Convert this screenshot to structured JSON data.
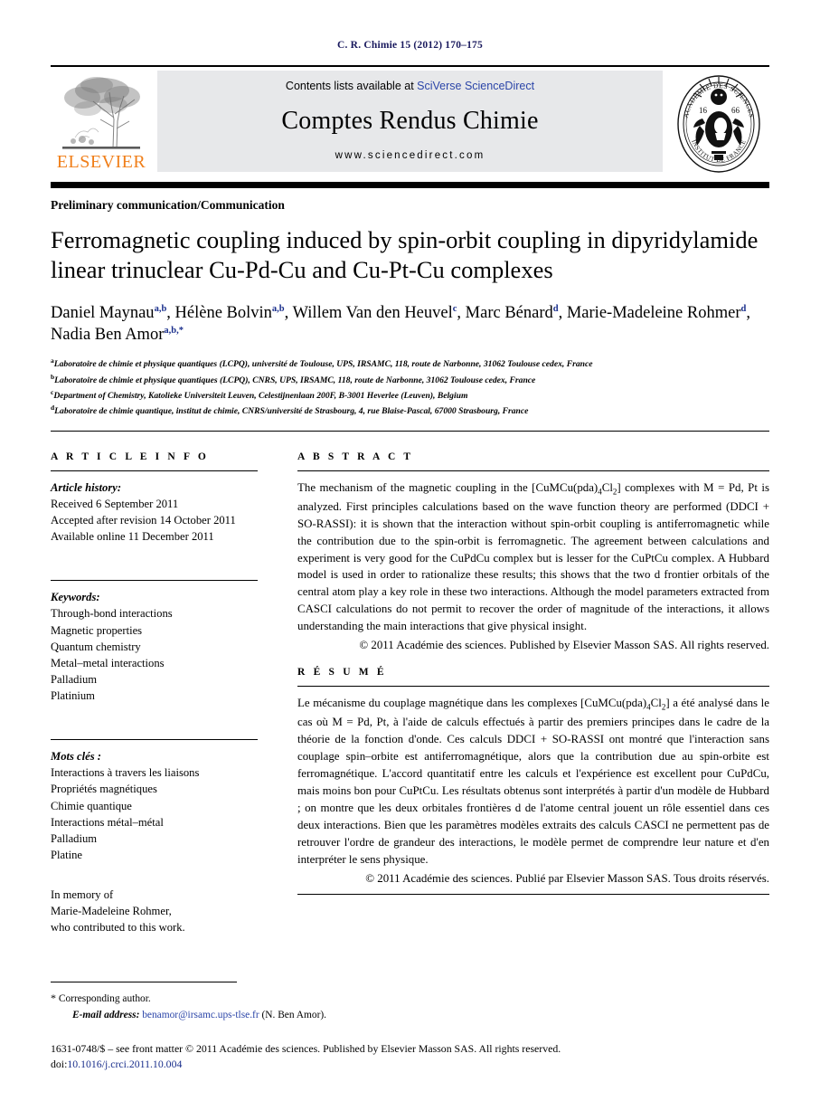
{
  "running_head": "C. R. Chimie 15 (2012) 170–175",
  "masthead": {
    "publisher_name": "ELSEVIER",
    "contents_prefix": "Contents lists available at ",
    "contents_link": "SciVerse ScienceDirect",
    "journal_title": "Comptes Rendus Chimie",
    "journal_url": "www.sciencedirect.com",
    "seal_outer_top": "ACADÉMIE DES",
    "seal_outer_bottom": "INSTITUT DE FRANCE",
    "seal_year_left": "16",
    "seal_year_right": "66"
  },
  "article": {
    "section_label": "Preliminary communication/Communication",
    "title_line1": "Ferromagnetic coupling induced by spin-orbit coupling in dipyridylamide",
    "title_line2": "linear trinuclear Cu-Pd-Cu and Cu-Pt-Cu complexes",
    "authors": [
      {
        "name": "Daniel Maynau",
        "marks": "a,b",
        "sep": ", "
      },
      {
        "name": "Hélène Bolvin",
        "marks": "a,b",
        "sep": ", "
      },
      {
        "name": "Willem Van den Heuvel",
        "marks": "c",
        "sep": ", "
      },
      {
        "name": "Marc Bénard",
        "marks": "d",
        "sep": ", "
      },
      {
        "name": "Marie-Madeleine Rohmer",
        "marks": "d",
        "sep": ", "
      },
      {
        "name": "Nadia Ben Amor",
        "marks": "a,b,*",
        "sep": ""
      }
    ],
    "affiliations": [
      {
        "mark": "a",
        "text": "Laboratoire de chimie et physique quantiques (LCPQ), université de Toulouse, UPS, IRSAMC, 118, route de Narbonne, 31062 Toulouse cedex, France"
      },
      {
        "mark": "b",
        "text": "Laboratoire de chimie et physique quantiques (LCPQ), CNRS, UPS, IRSAMC, 118, route de Narbonne, 31062 Toulouse cedex, France"
      },
      {
        "mark": "c",
        "text": "Department of Chemistry, Katolieke Universiteit Leuven, Celestijnenlaan 200F, B-3001 Heverlee (Leuven), Belgium"
      },
      {
        "mark": "d",
        "text": "Laboratoire de chimie quantique, institut de chimie, CNRS/université de Strasbourg, 4, rue Blaise-Pascal, 67000 Strasbourg, France"
      }
    ]
  },
  "info": {
    "heading": "A R T I C L E   I N F O",
    "history_label": "Article history:",
    "history": [
      "Received 6 September 2011",
      "Accepted after revision 14 October 2011",
      "Available online 11 December 2011"
    ],
    "keywords_label": "Keywords:",
    "keywords": [
      "Through-bond interactions",
      "Magnetic properties",
      "Quantum chemistry",
      "Metal–metal interactions",
      "Palladium",
      "Platinium"
    ],
    "motscles_label": "Mots clés :",
    "motscles": [
      "Interactions à travers les liaisons",
      "Propriétés magnétiques",
      "Chimie quantique",
      "Interactions métal–métal",
      "Palladium",
      "Platine"
    ],
    "memoriam": [
      "In memory of",
      "Marie-Madeleine Rohmer,",
      "who contributed to this work."
    ]
  },
  "abstract": {
    "heading": "A B S T R A C T",
    "body_part1": "The mechanism of the magnetic coupling in the [CuMCu(pda)",
    "body_sub1": "4",
    "body_part2": "Cl",
    "body_sub2": "2",
    "body_part3": "] complexes with M = Pd, Pt is analyzed. First principles calculations based on the wave function theory are performed (DDCI + SO-RASSI): it is shown that the interaction without spin-orbit coupling is antiferromagnetic while the contribution due to the spin-orbit is ferromagnetic. The agreement between calculations and experiment is very good for the CuPdCu complex but is lesser for the CuPtCu complex. A Hubbard model is used in order to rationalize these results; this shows that the two d frontier orbitals of the central atom play a key role in these two interactions. Although the model parameters extracted from CASCI calculations do not permit to recover the order of magnitude of the interactions, it allows understanding the main interactions that give physical insight.",
    "copyright": "© 2011 Académie des sciences. Published by Elsevier Masson SAS. All rights reserved."
  },
  "resume": {
    "heading": "R É S U M É",
    "body_part1": "Le mécanisme du couplage magnétique dans les complexes [CuMCu(pda)",
    "body_sub1": "4",
    "body_part2": "Cl",
    "body_sub2": "2",
    "body_part3": "] a été analysé dans le cas où M = Pd, Pt, à l'aide de calculs effectués à partir des premiers principes dans le cadre de la théorie de la fonction d'onde. Ces calculs DDCI + SO-RASSI ont montré que l'interaction sans couplage spin–orbite est antiferromagnétique, alors que la contribution due au spin-orbite est ferromagnétique. L'accord quantitatif entre les calculs et l'expérience est excellent pour CuPdCu, mais moins bon pour CuPtCu. Les résultats obtenus sont interprétés à partir d'un modèle de Hubbard ; on montre que les deux orbitales frontières d de l'atome central jouent un rôle essentiel dans ces deux interactions. Bien que les paramètres modèles extraits des calculs CASCI ne permettent pas de retrouver l'ordre de grandeur des interactions, le modèle permet de comprendre leur nature et d'en interpréter le sens physique.",
    "copyright": "© 2011 Académie des sciences. Publié par Elsevier Masson SAS. Tous droits réservés."
  },
  "footer": {
    "corresponding_star": "*",
    "corresponding_label": "Corresponding author.",
    "email_label": "E-mail address:",
    "email": "benamor@irsamc.ups-tlse.fr",
    "email_suffix": "(N. Ben Amor).",
    "imprint": "1631-0748/$ – see front matter © 2011 Académie des sciences. Published by Elsevier Masson SAS. All rights reserved.",
    "doi_prefix": "doi:",
    "doi": "10.1016/j.crci.2011.10.004"
  }
}
